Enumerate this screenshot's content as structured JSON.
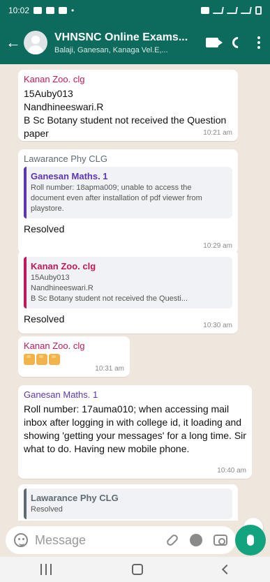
{
  "status_bar": {
    "time": "10:02",
    "left_icons": [
      "message-icon",
      "whatsapp-icon",
      "whatsapp-icon",
      "dot-icon"
    ],
    "right_icons": [
      "sim-icon",
      "wifi-icon",
      "signal-icon",
      "signal-icon",
      "battery-icon"
    ]
  },
  "header": {
    "title": "VHNSNC Online Exams...",
    "subtitle": "Balaji, Ganesan, Kanaga Vel.E,...",
    "color": "#0d6b5e"
  },
  "messages": [
    {
      "sender": "Kanan Zoo. clg",
      "sender_color": "#c2185b",
      "text": "15Auby013\nNandhineeswari.R\nB Sc Botany student not received the Question paper",
      "time": "10:21 am"
    },
    {
      "sender": "Lawarance Phy CLG",
      "sender_color": "#5f6b73",
      "quote": {
        "sender": "Ganesan Maths. 1",
        "sender_color": "#5e35b1",
        "text": "Roll number: 18apma009; unable to access the document even after installation of pdf viewer from playstore."
      },
      "text": "Resolved",
      "time": "10:29 am"
    },
    {
      "quote": {
        "sender": "Kanan Zoo. clg",
        "sender_color": "#c2185b",
        "text": "15Auby013\nNandhineeswari.R\nB Sc Botany student not received the Questi..."
      },
      "text": "Resolved",
      "time": "10:30 am"
    },
    {
      "sender": "Kanan Zoo. clg",
      "sender_color": "#c2185b",
      "emoji_icons": [
        "thumbs-up-icon",
        "thumbs-up-icon",
        "thumbs-up-icon"
      ],
      "time": "10:31 am"
    },
    {
      "sender": "Ganesan Maths. 1",
      "sender_color": "#5e35b1",
      "text": "Roll number: 17auma010; when accessing mail inbox after logging in with college id, it loading and showing 'getting your messages' for a long time. Sir what to do. Having new mobile phone.",
      "time": "10:40 am"
    },
    {
      "quote": {
        "sender": "Lawarance Phy CLG",
        "sender_color": "#5f6b73",
        "text": "Resolved"
      }
    }
  ],
  "input": {
    "placeholder": "Message"
  }
}
